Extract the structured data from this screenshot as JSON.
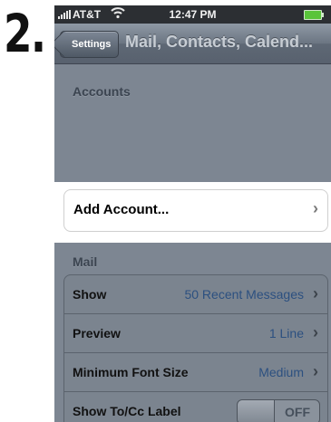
{
  "step_number": "2.",
  "status_bar": {
    "carrier": "AT&T",
    "time": "12:47 PM",
    "signal_icon": "signal-bars-icon",
    "wifi_icon": "wifi-icon",
    "battery_icon": "battery-icon"
  },
  "nav": {
    "back_label": "Settings",
    "title": "Mail, Contacts, Calend..."
  },
  "accounts": {
    "header": "Accounts",
    "add_account_label": "Add Account..."
  },
  "mail": {
    "header": "Mail",
    "rows": [
      {
        "label": "Show",
        "value": "50 Recent Messages"
      },
      {
        "label": "Preview",
        "value": "1 Line"
      },
      {
        "label": "Minimum Font Size",
        "value": "Medium"
      },
      {
        "label": "Show To/Cc Label",
        "toggle": "OFF"
      }
    ]
  },
  "colors": {
    "nav_bar": "#6b7582",
    "dimmed_background": "#7d8692",
    "value_text": "#2c5080"
  }
}
